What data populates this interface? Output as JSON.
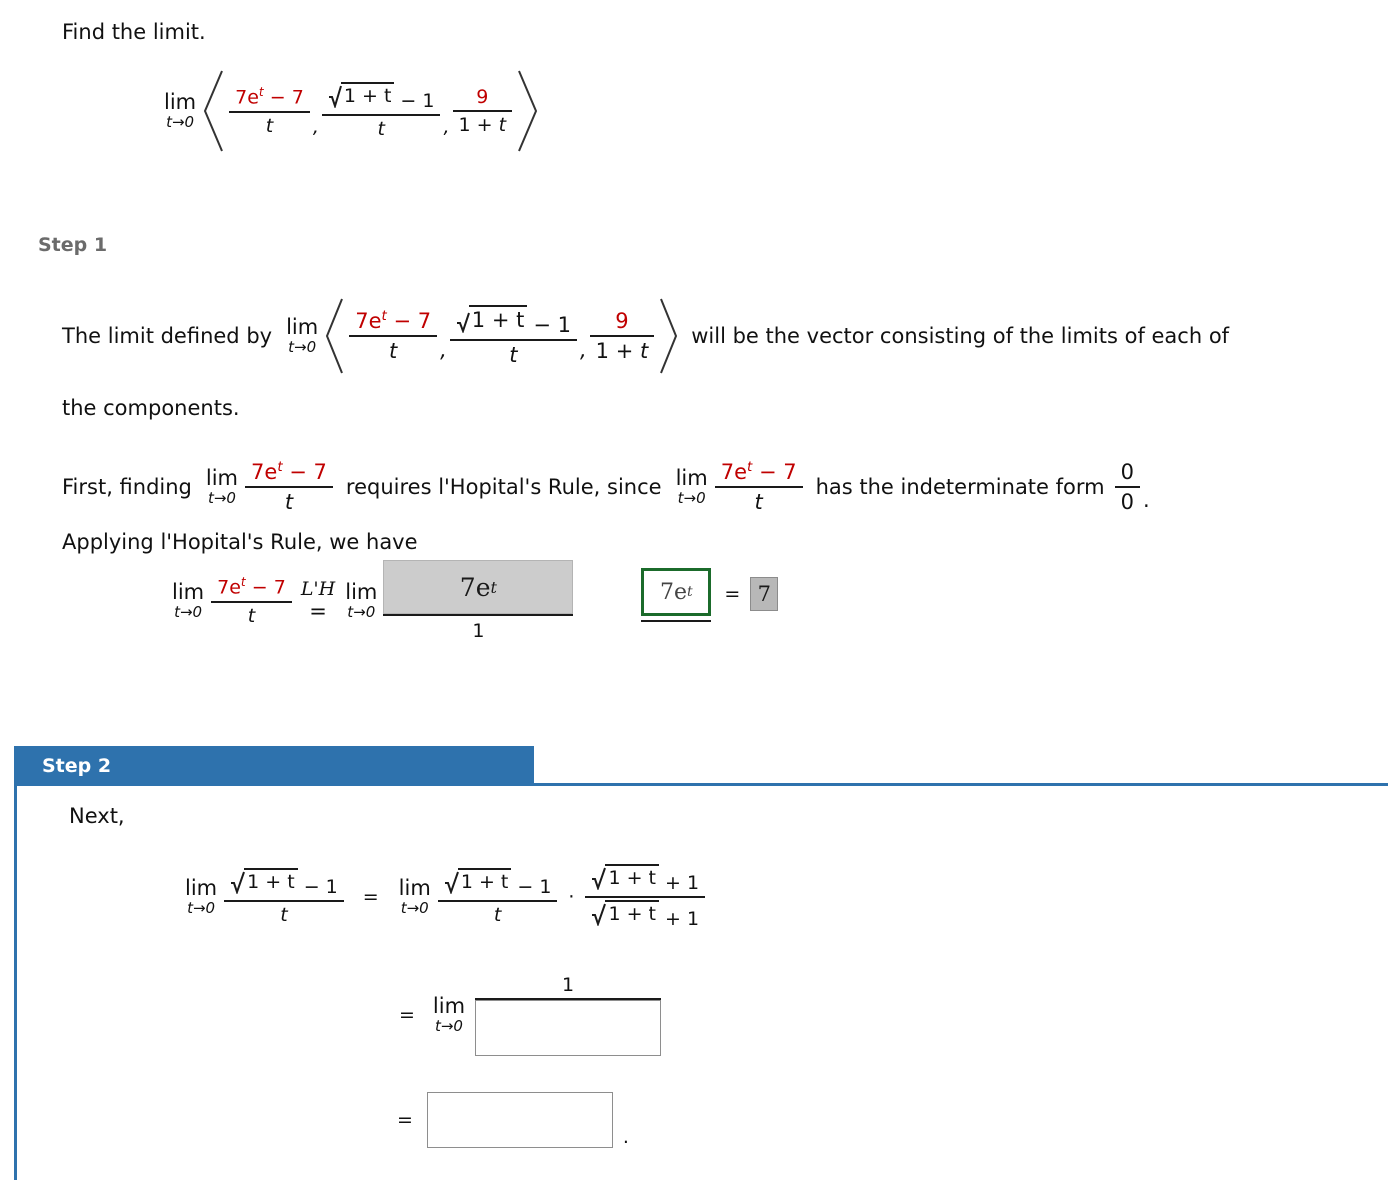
{
  "prompt": {
    "text": "Find the limit."
  },
  "symbols": {
    "lim": "lim",
    "t_to_0": "t→0",
    "t": "t",
    "comma": ",",
    "equals": "=",
    "dot": "·",
    "one": "1",
    "period": ".",
    "nine": "9",
    "one_plus_t": "1 + t",
    "minus_one": "− 1",
    "plus_one": "+ 1",
    "seven_e_t_minus_seven_lead": "7e",
    "seven_e_t_minus_seven_tail": "− 7",
    "exp_t": "t",
    "lhopital_tag": "L'H"
  },
  "main_expression": {
    "lim": "lim",
    "sub": "t→0",
    "component1": {
      "num_lead": "7e",
      "num_sup": "t",
      "num_tail": "− 7",
      "den": "t"
    },
    "component2": {
      "radicand": "1 + t",
      "after_radical": "− 1",
      "den": "t"
    },
    "component3": {
      "num": "9",
      "den": "1 + t"
    }
  },
  "step1": {
    "label": "Step 1",
    "sentence_lead": "The limit defined by",
    "sentence_tail": "will be the vector consisting of the limits of each of",
    "sentence_line2": "the components.",
    "first_finding_lead": "First, finding",
    "first_finding_mid": "requires l'Hopital's Rule, since",
    "first_finding_tail": "has the indeterminate form",
    "indeterminate_num": "0",
    "indeterminate_den": "0",
    "indeterminate_period": ".",
    "applying": "Applying l'Hopital's Rule, we have",
    "work": {
      "lhopital_tag": "L'H",
      "equals": "=",
      "answer_box_numerator": "7e",
      "answer_box_numerator_sup": "t",
      "denominator": "1",
      "green_box_value": "7e",
      "green_box_value_sup": "t",
      "final_equals": "=",
      "final_value": "7"
    }
  },
  "step2": {
    "label": "Step 2",
    "next": "Next,",
    "eq1": {
      "lim": "lim",
      "sub": "t→0",
      "lhs_radicand": "1 + t",
      "lhs_after": "− 1",
      "lhs_den": "t",
      "equals": "=",
      "rhs_radicand": "1 + t",
      "rhs_after": "− 1",
      "rhs_den": "t",
      "dot": "·",
      "conj_num_radicand": "1 + t",
      "conj_num_after": "+ 1",
      "conj_den_radicand": "1 + t",
      "conj_den_after": "+ 1"
    },
    "eq2": {
      "equals": "=",
      "lim": "lim",
      "sub": "t→0",
      "numerator": "1",
      "denominator_input_value": "",
      "denominator_input_placeholder": ""
    },
    "eq3": {
      "equals": "=",
      "input_value": "",
      "input_placeholder": "",
      "period": "."
    }
  },
  "colors": {
    "accent_blue": "#2e72ad",
    "highlight_red": "#c00000",
    "answer_box_gray": "#cccccc",
    "correct_green": "#1b6b2b",
    "step_label_gray": "#6b6b6b"
  }
}
